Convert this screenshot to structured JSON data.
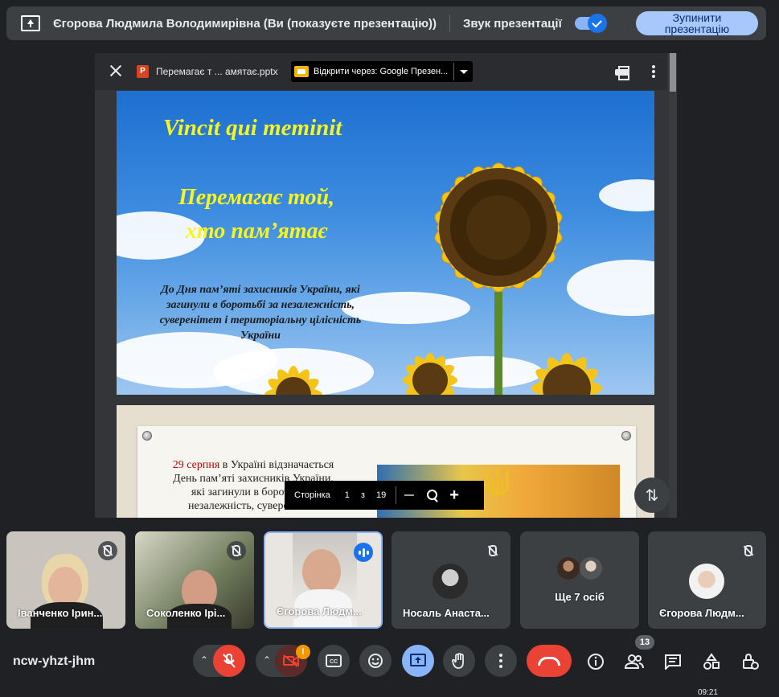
{
  "topbar": {
    "presenter": "Єгорова Людмила Володимирівна (Ви (показуєте презентацію))",
    "sound_label": "Звук презентації",
    "sound_on": true,
    "stop_button": "Зупинити презентацію"
  },
  "viewer": {
    "file_icon": "P",
    "filename": "Перемагає т ... амятає.pptx",
    "open_with": "Відкрити через: Google Презен...",
    "page_label": "Сторінка",
    "page_current": "1",
    "page_of": "з",
    "page_total": "19"
  },
  "slide1": {
    "title": "Vincit qui meminit",
    "subtitle_line1": "Перемагає той,",
    "subtitle_line2": "хто пам’ятає",
    "body": "До Дня пам’яті захисників України, які загинули в боротьбі за незалежність, суверенітет і територіальну цілісність України"
  },
  "slide2": {
    "date": "29 серпня",
    "text_rest": " в Україні відзначається День пам’яті захисників України, які загинули в боротьбі за незалежність, суверенітет і"
  },
  "participants": [
    {
      "name": "Іванченко Ірин...",
      "muted": true
    },
    {
      "name": "Соколенко Ірі...",
      "muted": true
    },
    {
      "name": "Єгорова Людм...",
      "speaking": true
    },
    {
      "name": "Носаль Анаста...",
      "muted": true
    },
    {
      "name": "Ще 7 осіб"
    },
    {
      "name": "Єгорова Людм...",
      "muted": true
    }
  ],
  "toolbar": {
    "meeting_code": "ncw-yhzt-jhm",
    "camera_warning": "!",
    "people_count": "13",
    "clock": "09:21"
  },
  "colors": {
    "background": "#202124",
    "accent": "#8ab4f8",
    "end_call": "#ea4335",
    "slide_title": "#f7f51c"
  }
}
